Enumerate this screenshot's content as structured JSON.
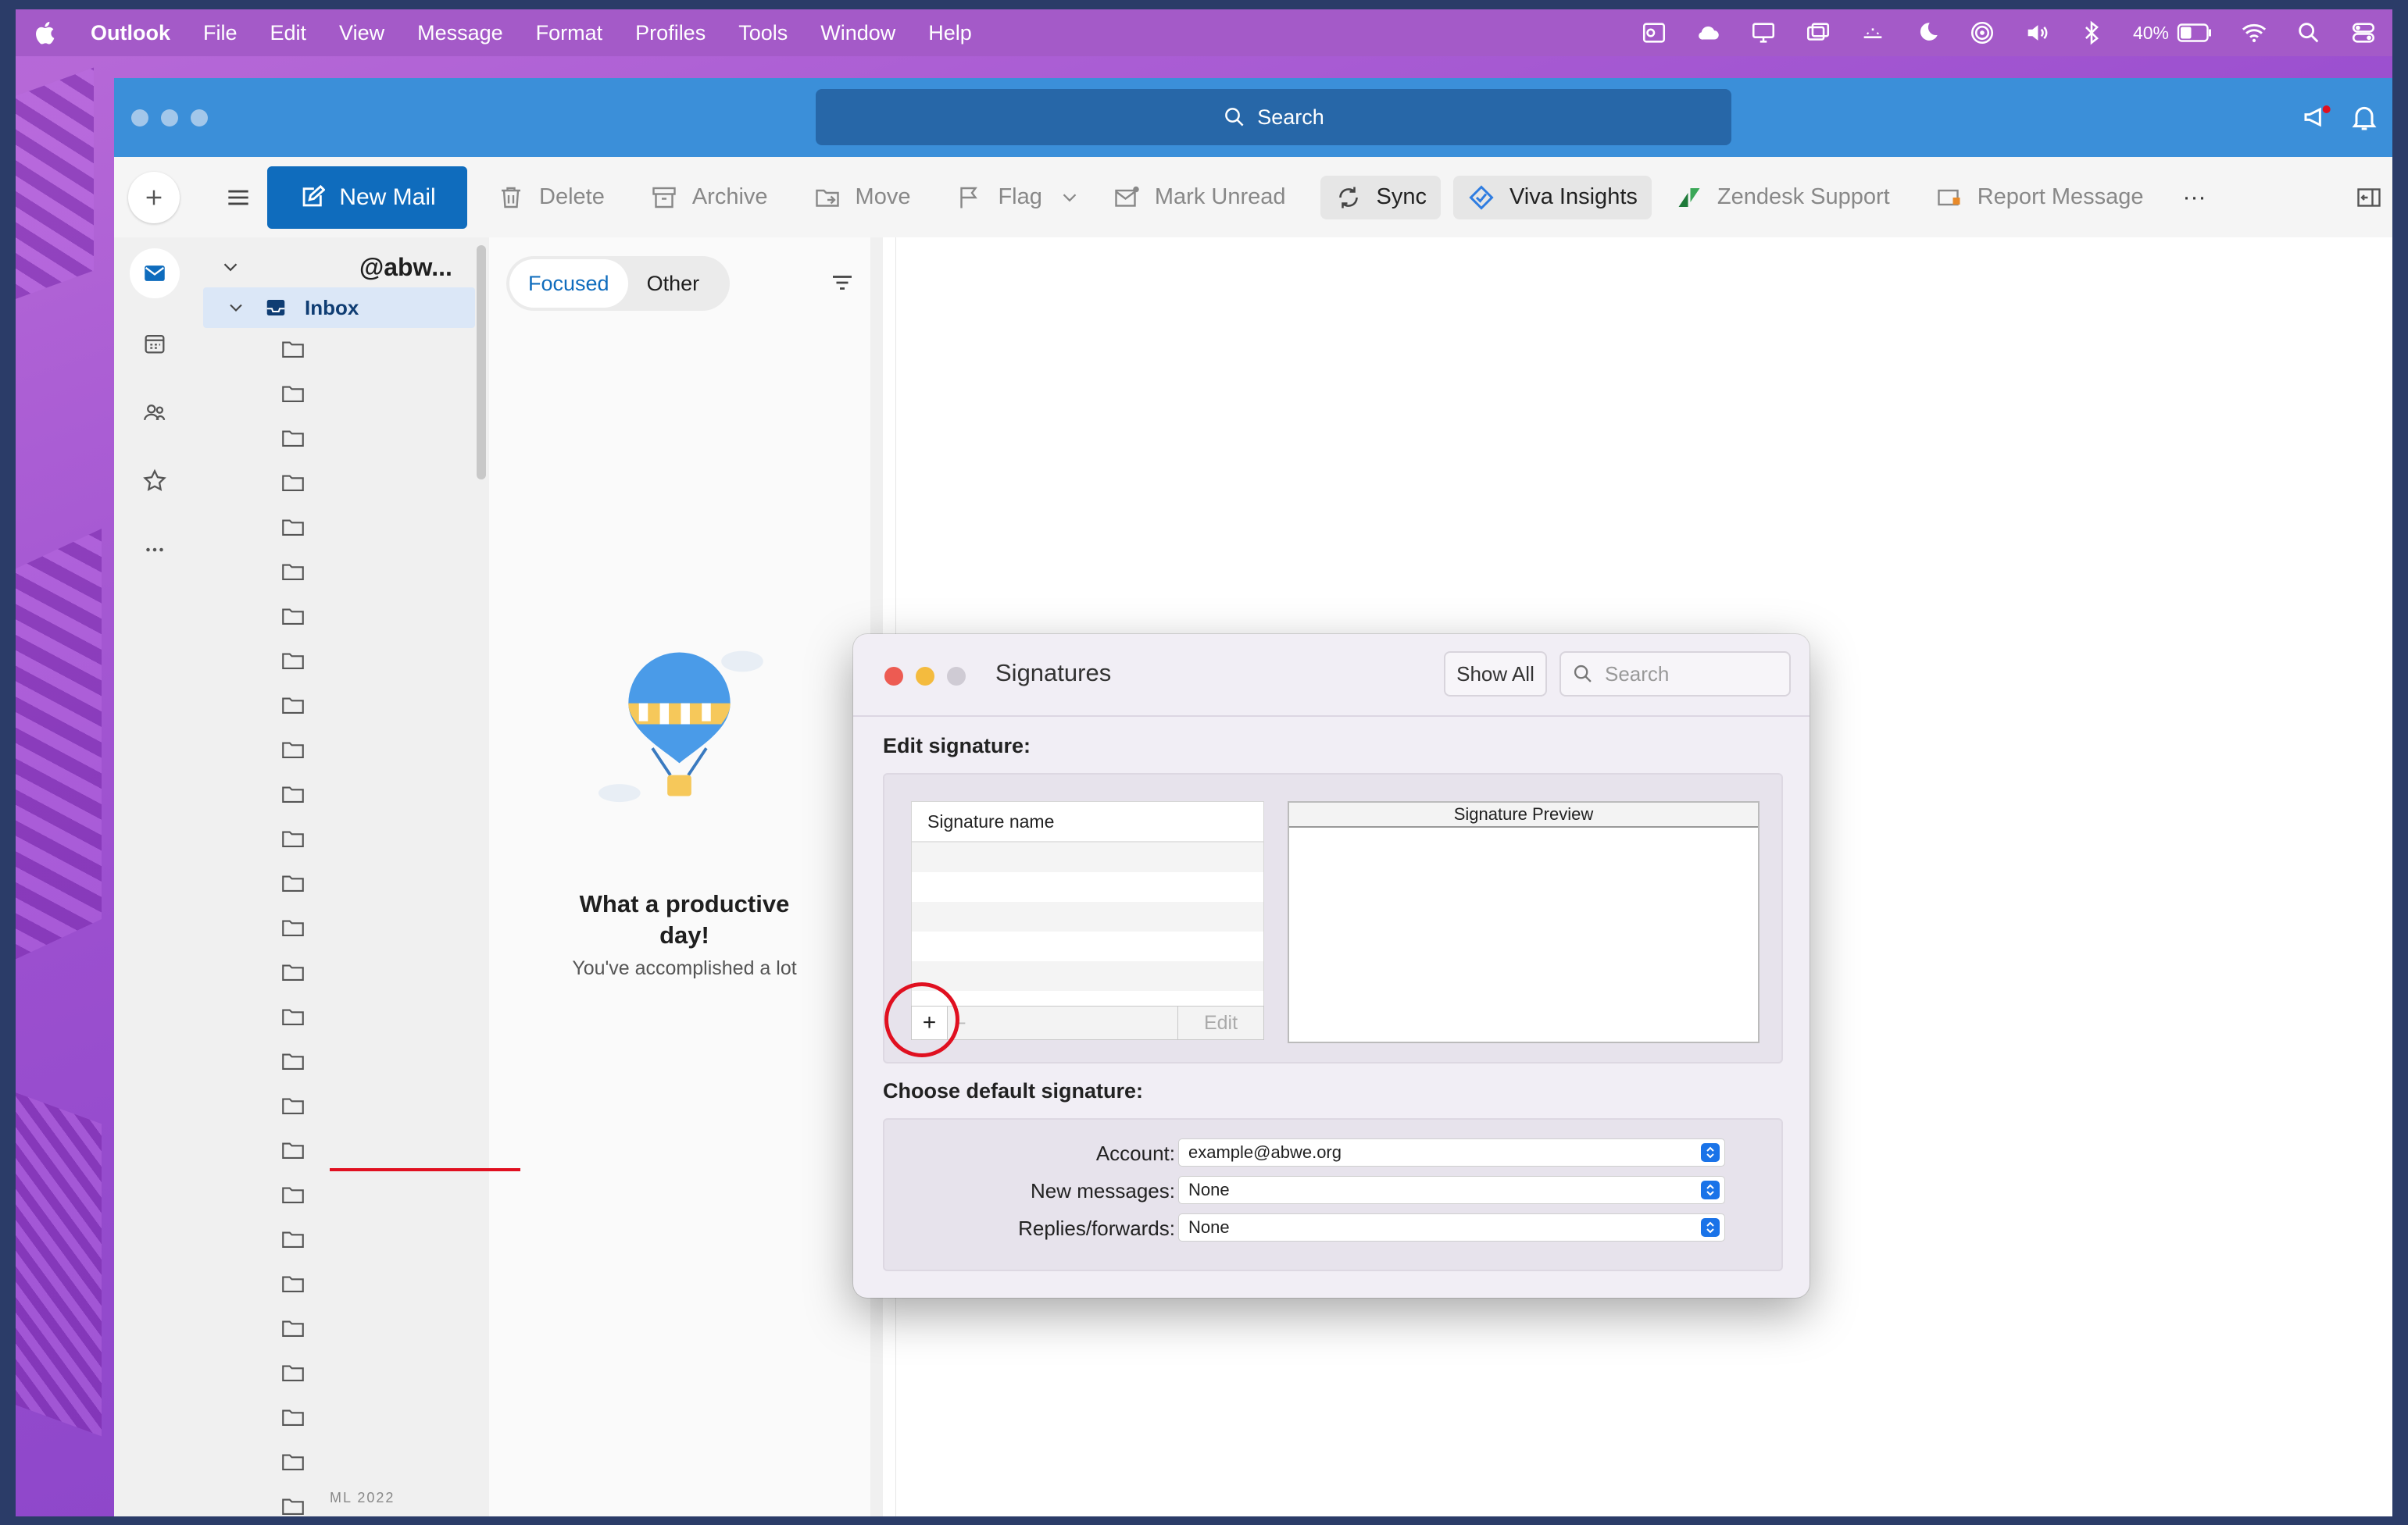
{
  "menubar": {
    "app_name": "Outlook",
    "items": [
      "File",
      "Edit",
      "View",
      "Message",
      "Format",
      "Profiles",
      "Tools",
      "Window",
      "Help"
    ],
    "battery_percent": "40%"
  },
  "titlebar": {
    "search_label": "Search"
  },
  "toolbar": {
    "new_mail": "New Mail",
    "delete": "Delete",
    "archive": "Archive",
    "move": "Move",
    "flag": "Flag",
    "mark_unread": "Mark Unread",
    "sync": "Sync",
    "viva": "Viva Insights",
    "zendesk": "Zendesk Support",
    "report": "Report Message",
    "more": "···"
  },
  "folders": {
    "account": "@abw...",
    "inbox": "Inbox",
    "last_label": "ML 2022"
  },
  "message_list": {
    "tab_focused": "Focused",
    "tab_other": "Other",
    "empty_title": "What a productive day!",
    "empty_subtitle": "You've accomplished a lot"
  },
  "dialog": {
    "title": "Signatures",
    "show_all": "Show All",
    "search_placeholder": "Search",
    "edit_heading": "Edit signature:",
    "sig_name_header": "Signature name",
    "preview_header": "Signature Preview",
    "plus": "+",
    "minus": "−",
    "edit": "Edit",
    "default_heading": "Choose default signature:",
    "account_label": "Account:",
    "account_value": "example@abwe.org",
    "new_messages_label": "New messages:",
    "new_messages_value": "None",
    "replies_label": "Replies/forwards:",
    "replies_value": "None"
  },
  "colors": {
    "accent": "#0f6cbd",
    "titlebar": "#3b8fd9",
    "annotation_red": "#e01020"
  }
}
